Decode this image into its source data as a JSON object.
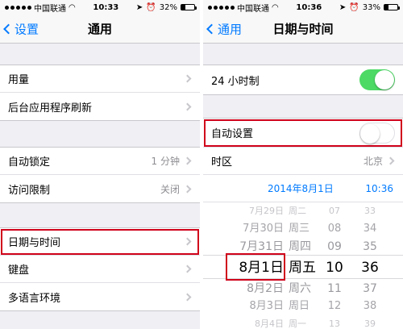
{
  "left": {
    "status": {
      "carrier": "中国联通",
      "time": "10:33",
      "battery": "32%",
      "battery_fill": 0.32
    },
    "nav": {
      "back": "设置",
      "title": "通用"
    },
    "groups": [
      [
        {
          "label": "用量"
        },
        {
          "label": "后台应用程序刷新"
        }
      ],
      [
        {
          "label": "自动锁定",
          "value": "1 分钟"
        },
        {
          "label": "访问限制",
          "value": "关闭"
        }
      ],
      [
        {
          "label": "日期与时间"
        },
        {
          "label": "键盘"
        },
        {
          "label": "多语言环境"
        }
      ]
    ]
  },
  "right": {
    "status": {
      "carrier": "中国联通",
      "time": "10:36",
      "battery": "33%",
      "battery_fill": 0.33
    },
    "nav": {
      "back": "通用",
      "title": "日期与时间"
    },
    "hour24": {
      "label": "24 小时制",
      "on": true
    },
    "auto": {
      "label": "自动设置",
      "on": false
    },
    "timezone": {
      "label": "时区",
      "value": "北京"
    },
    "date_display": {
      "date": "2014年8月1日",
      "time": "10:36"
    },
    "picker": {
      "dates": [
        "7月29日",
        "7月30日",
        "7月31日",
        "8月1日",
        "8月2日",
        "8月3日",
        "8月4日"
      ],
      "weekdays": [
        "周二",
        "周三",
        "周四",
        "周五",
        "周六",
        "周日",
        "周一"
      ],
      "hours": [
        "07",
        "08",
        "09",
        "10",
        "11",
        "12",
        "13"
      ],
      "minutes": [
        "33",
        "34",
        "35",
        "36",
        "37",
        "38",
        "39"
      ]
    }
  }
}
